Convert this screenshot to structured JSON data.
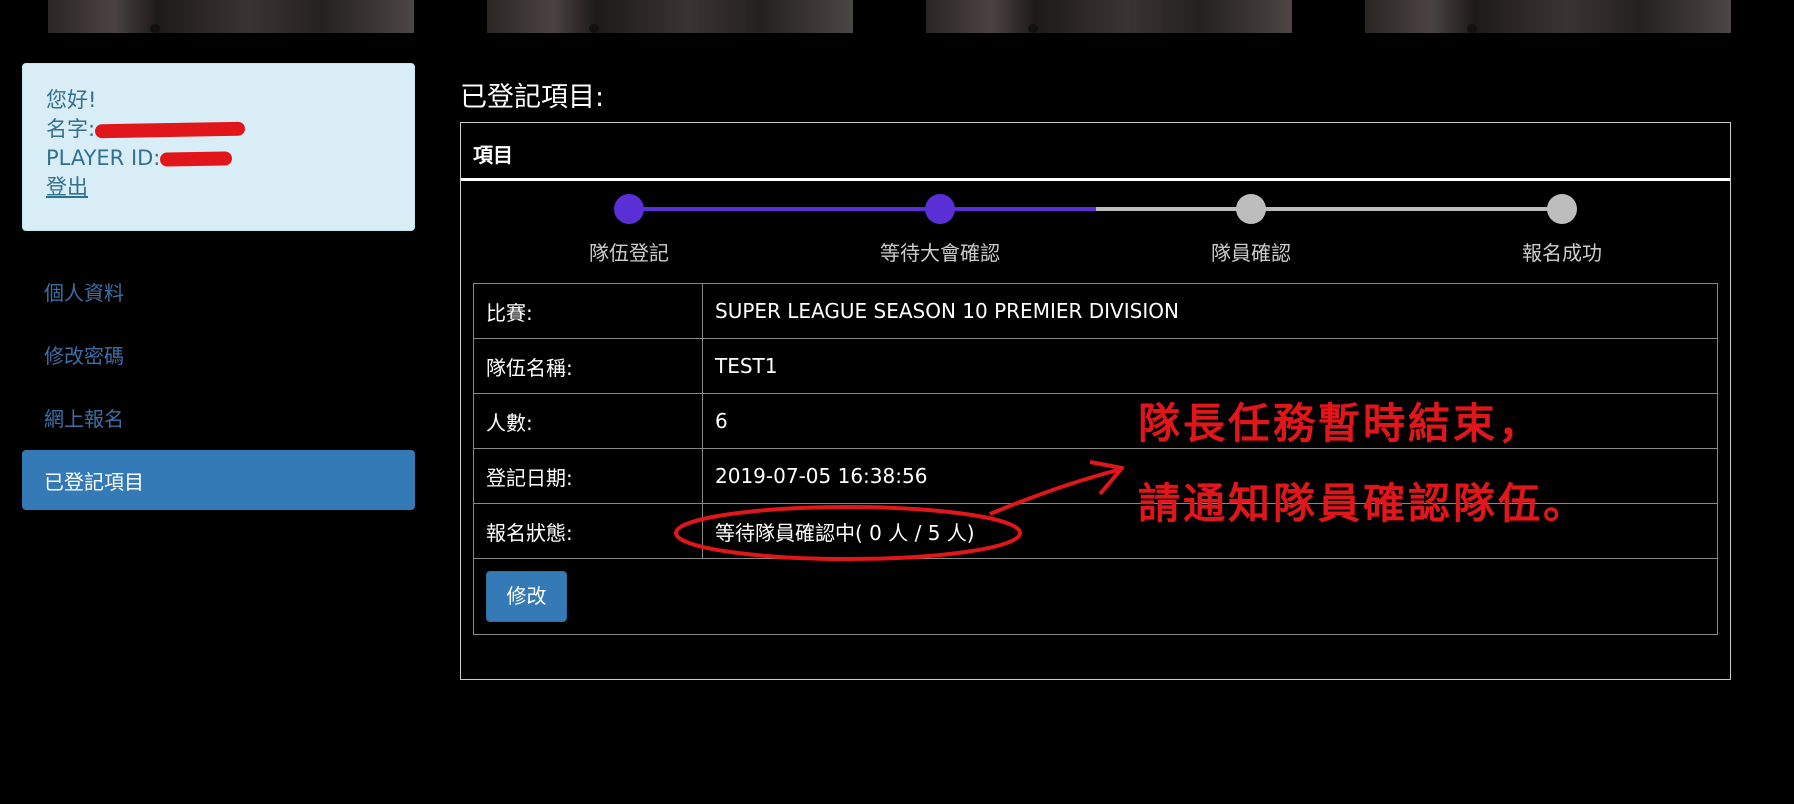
{
  "user_box": {
    "greeting": "您好!",
    "name_label": "名字:",
    "player_id_label": "PLAYER ID:",
    "logout": "登出"
  },
  "nav": {
    "items": [
      {
        "label": "個人資料",
        "active": false
      },
      {
        "label": "修改密碼",
        "active": false
      },
      {
        "label": "網上報名",
        "active": false
      },
      {
        "label": "已登記項目",
        "active": true
      }
    ]
  },
  "main": {
    "heading": "已登記項目:",
    "panel_title": "項目"
  },
  "progress": {
    "steps": [
      "隊伍登記",
      "等待大會確認",
      "隊員確認",
      "報名成功"
    ],
    "completed_steps": 2,
    "active_color": "#5a2fd6",
    "inactive_color": "#bdbdbd"
  },
  "details": {
    "rows": [
      {
        "label": "比賽:",
        "value": "SUPER LEAGUE SEASON 10 PREMIER DIVISION"
      },
      {
        "label": "隊伍名稱:",
        "value": "TEST1"
      },
      {
        "label": "人數:",
        "value": "6"
      },
      {
        "label": "登記日期:",
        "value": "2019-07-05 16:38:56"
      },
      {
        "label": "報名狀態:",
        "value": "等待隊員確認中( 0 人 / 5 人)"
      }
    ],
    "edit_button": "修改"
  },
  "annotation": {
    "line1": "隊長任務暫時結束，",
    "line2": "請通知隊員確認隊伍。",
    "color": "#e0161b"
  }
}
